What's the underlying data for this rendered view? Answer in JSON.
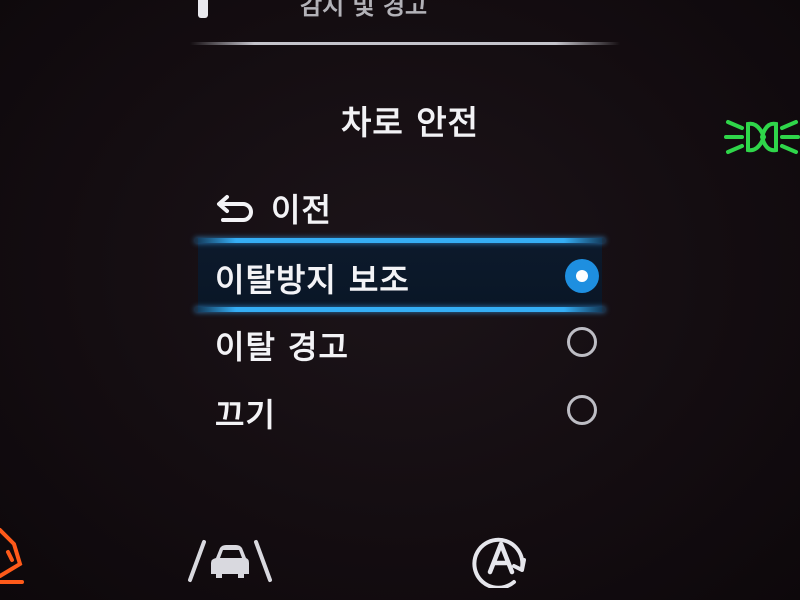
{
  "menu": {
    "title": "차로 안전",
    "back_label": "이전",
    "options": [
      {
        "label": "이탈방지 보조",
        "selected": true
      },
      {
        "label": "이탈 경고",
        "selected": false
      },
      {
        "label": "끄기",
        "selected": false
      }
    ]
  },
  "top_partial_text": "감지 및 경고",
  "icons": {
    "back": "return-arrow-icon",
    "headlight": "headlight-indicator-icon",
    "warning": "warning-indicator-icon",
    "lane_assist": "lane-assist-icon",
    "auto_hold": "auto-hold-icon"
  },
  "colors": {
    "accent": "#35aef5",
    "selected_radio": "#1e8fe0",
    "headlight_green": "#2fd64a",
    "warning_orange": "#ff5a1a",
    "text": "#f3f3f6"
  }
}
